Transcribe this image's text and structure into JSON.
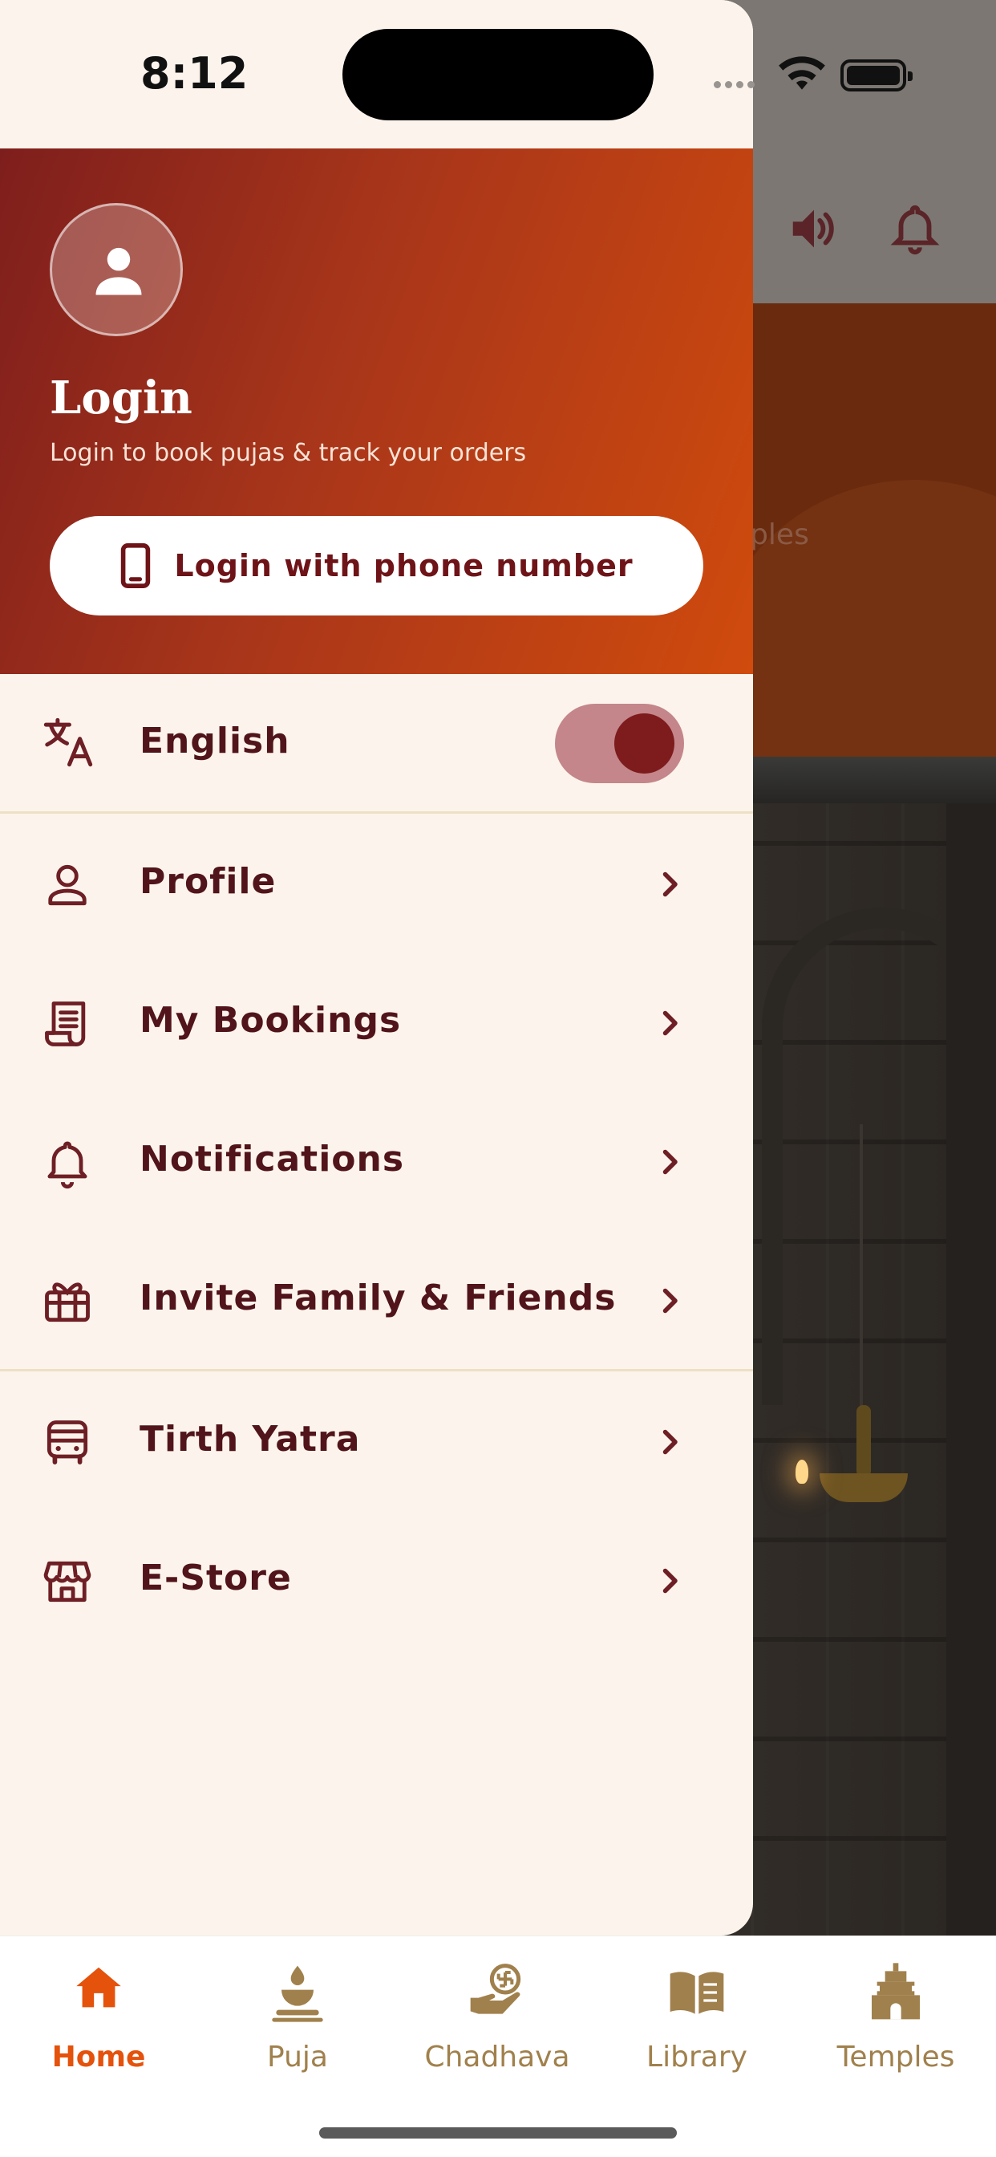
{
  "status_bar": {
    "time": "8:12"
  },
  "background_app": {
    "peek_text": "mples"
  },
  "drawer": {
    "header": {
      "title": "Login",
      "subtitle": "Login to book pujas & track your orders",
      "login_button": "Login with phone number"
    },
    "language": {
      "label": "English",
      "toggle_on": true
    },
    "menu": [
      {
        "label": "Profile",
        "icon": "person-icon"
      },
      {
        "label": "My Bookings",
        "icon": "receipt-icon"
      },
      {
        "label": "Notifications",
        "icon": "bell-icon"
      },
      {
        "label": "Invite Family & Friends",
        "icon": "gift-icon"
      },
      {
        "label": "Tirth Yatra",
        "icon": "bus-icon"
      },
      {
        "label": "E-Store",
        "icon": "store-icon"
      }
    ]
  },
  "bottom_nav": [
    {
      "label": "Home",
      "icon": "home-icon",
      "active": true
    },
    {
      "label": "Puja",
      "icon": "puja-lamp-icon",
      "active": false
    },
    {
      "label": "Chadhava",
      "icon": "offering-hand-icon",
      "active": false
    },
    {
      "label": "Library",
      "icon": "book-icon",
      "active": false
    },
    {
      "label": "Temples",
      "icon": "temple-icon",
      "active": false
    }
  ],
  "colors": {
    "accent": "#e4520c",
    "maroon": "#51141b",
    "header_gradient_start": "#7e1e1c",
    "header_gradient_end": "#d04b0d",
    "drawer_bg": "#fcf4ec",
    "nav_inactive": "#a0804c"
  }
}
